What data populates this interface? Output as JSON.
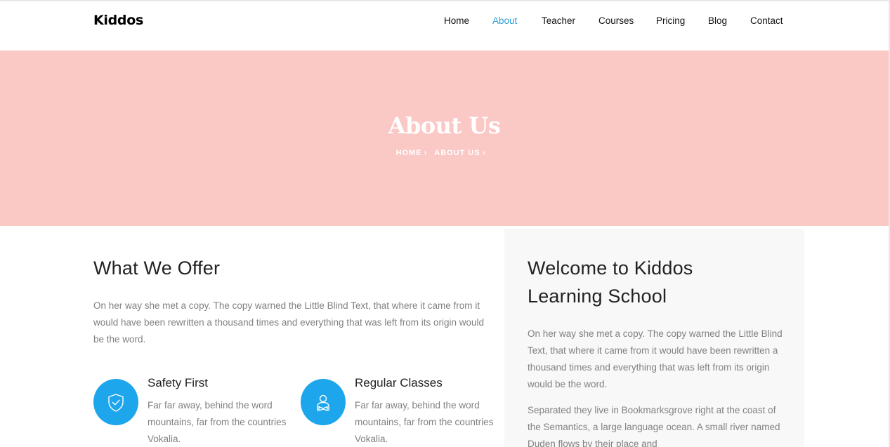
{
  "header": {
    "brand": "Kiddos",
    "nav": [
      {
        "label": "Home",
        "active": false
      },
      {
        "label": "About",
        "active": true
      },
      {
        "label": "Teacher",
        "active": false
      },
      {
        "label": "Courses",
        "active": false
      },
      {
        "label": "Pricing",
        "active": false
      },
      {
        "label": "Blog",
        "active": false
      },
      {
        "label": "Contact",
        "active": false
      }
    ]
  },
  "hero": {
    "title": "About Us",
    "breadcrumb": [
      "HOME",
      "ABOUT US"
    ],
    "background": "#fac8c5"
  },
  "offer": {
    "heading": "What We Offer",
    "text": "On her way she met a copy. The copy warned the Little Blind Text, that where it came from it would have been rewritten a thousand times and everything that was left from its origin would be the word.",
    "features": [
      {
        "title": "Safety First",
        "text": "Far far away, behind the word mountains, far from the countries Vokalia.",
        "icon": "shield-check-icon"
      },
      {
        "title": "Regular Classes",
        "text": "Far far away, behind the word mountains, far from the countries Vokalia.",
        "icon": "reading-student-icon"
      }
    ],
    "accent": "#1da6ec"
  },
  "welcome": {
    "heading_line1": "Welcome to Kiddos",
    "heading_line2": "Learning School",
    "text1": "On her way she met a copy. The copy warned the Little Blind Text, that where it came from it would have been rewritten a thousand times and everything that was left from its origin would be the word.",
    "text2": "Separated they live in Bookmarksgrove right at the coast of the Semantics, a large language ocean. A small river named Duden flows by their place and"
  }
}
